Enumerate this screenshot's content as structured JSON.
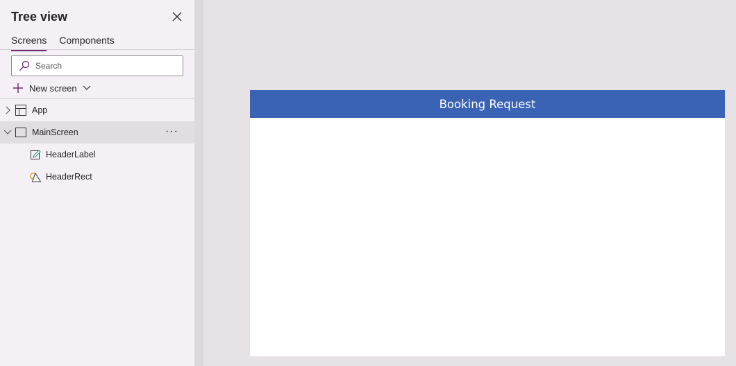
{
  "panel": {
    "title": "Tree view",
    "tabs": [
      {
        "label": "Screens",
        "active": true
      },
      {
        "label": "Components",
        "active": false
      }
    ],
    "search": {
      "placeholder": "Search"
    },
    "new_screen_label": "New screen",
    "tree": {
      "app": {
        "label": "App",
        "icon": "app-icon"
      },
      "main_screen": {
        "label": "MainScreen",
        "icon": "screen-icon",
        "more": "···"
      },
      "children": [
        {
          "label": "HeaderLabel",
          "icon": "label-edit-icon"
        },
        {
          "label": "HeaderRect",
          "icon": "shape-icon"
        }
      ]
    }
  },
  "canvas": {
    "header_text": "Booking Request",
    "header_color": "#3a62b5"
  },
  "colors": {
    "accent": "#742774",
    "panel_bg": "#f5f0f5",
    "workspace_bg": "#e6e2e6"
  }
}
